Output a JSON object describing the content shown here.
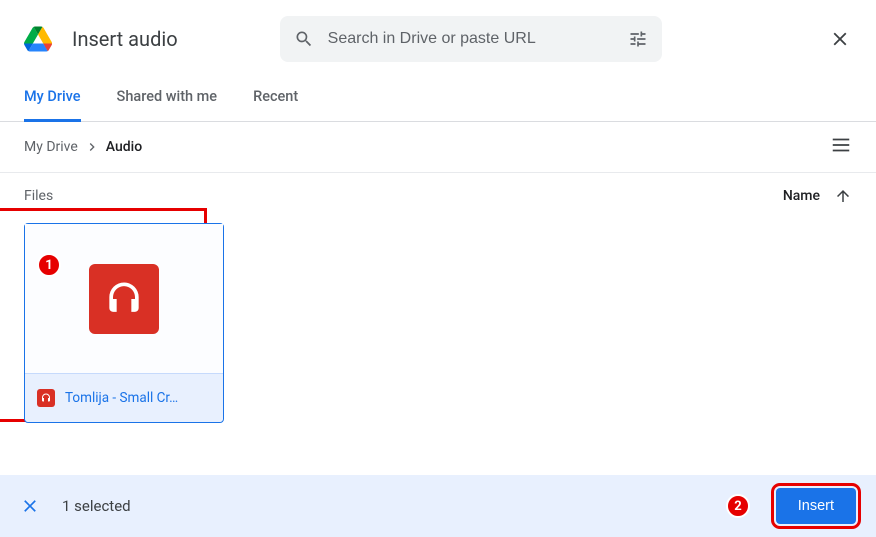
{
  "header": {
    "title": "Insert audio",
    "search_placeholder": "Search in Drive or paste URL"
  },
  "tabs": [
    {
      "label": "My Drive",
      "active": true
    },
    {
      "label": "Shared with me",
      "active": false
    },
    {
      "label": "Recent",
      "active": false
    }
  ],
  "breadcrumb": {
    "root": "My Drive",
    "current": "Audio"
  },
  "files": {
    "section_label": "Files",
    "sort_label": "Name",
    "items": [
      {
        "name": "Tomlija - Small Cr…",
        "selected": true
      }
    ]
  },
  "footer": {
    "selected_text": "1 selected",
    "insert_label": "Insert"
  },
  "annotations": {
    "a1": "1",
    "a2": "2"
  }
}
